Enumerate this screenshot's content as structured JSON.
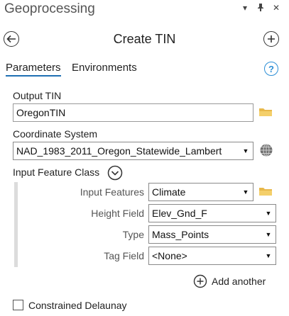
{
  "pane": {
    "title": "Geoprocessing",
    "controls": [
      "▾",
      "⊓",
      "✕"
    ]
  },
  "header": {
    "tool_title": "Create TIN"
  },
  "tabs": [
    {
      "label": "Parameters",
      "active": true
    },
    {
      "label": "Environments",
      "active": false
    }
  ],
  "help_glyph": "?",
  "params": {
    "output_tin": {
      "label": "Output TIN",
      "value": "OregonTIN"
    },
    "coord_system": {
      "label": "Coordinate System",
      "value": "NAD_1983_2011_Oregon_Statewide_Lambert"
    },
    "input_feature_class": {
      "label": "Input Feature Class"
    },
    "features": {
      "input_features": {
        "label": "Input Features",
        "value": "Climate"
      },
      "height_field": {
        "label": "Height Field",
        "value": "Elev_Gnd_F"
      },
      "type": {
        "label": "Type",
        "value": "Mass_Points"
      },
      "tag_field": {
        "label": "Tag Field",
        "value": "<None>"
      }
    },
    "add_another": "Add another",
    "constrained_delaunay": {
      "label": "Constrained Delaunay",
      "checked": false
    }
  },
  "colors": {
    "accent": "#1f6fb3",
    "folder": "#e8b84a",
    "help": "#2d8fd6"
  }
}
